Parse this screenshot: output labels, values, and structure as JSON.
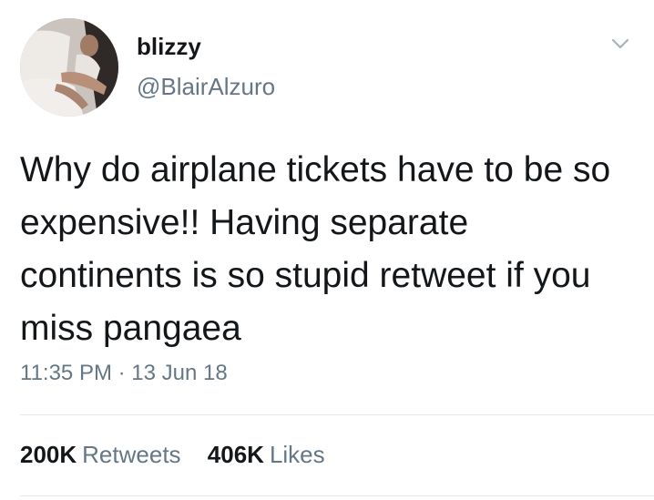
{
  "tweet": {
    "avatar_icon": "profile-photo",
    "display_name": "blizzy",
    "handle": "@BlairAlzuro",
    "menu_icon": "chevron-down-icon",
    "text": "Why do airplane tickets have to be so expensive!! Having separate continents is so stupid retweet if you miss pangaea",
    "timestamp": "11:35 PM · 13 Jun 18",
    "stats": {
      "retweets_count": "200K",
      "retweets_label": "Retweets",
      "likes_count": "406K",
      "likes_label": "Likes"
    }
  },
  "colors": {
    "primary_text": "#14171a",
    "secondary_text": "#657786",
    "divider": "#e1e8ed"
  }
}
